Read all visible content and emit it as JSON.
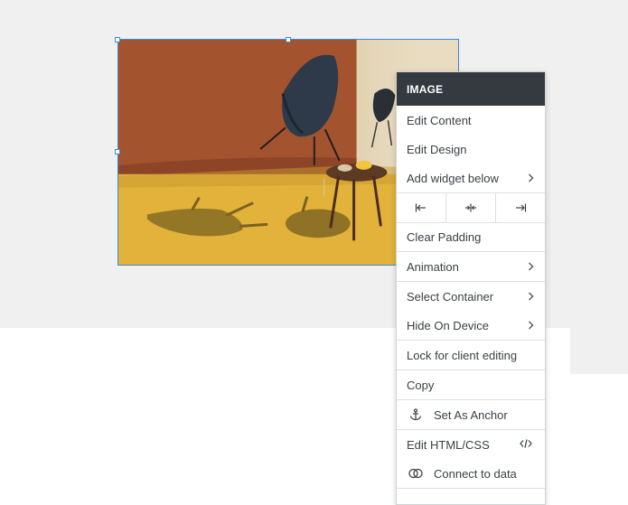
{
  "menu": {
    "header": "IMAGE",
    "edit_content": "Edit Content",
    "edit_design": "Edit Design",
    "add_widget_below": "Add widget below",
    "clear_padding": "Clear Padding",
    "animation": "Animation",
    "select_container": "Select Container",
    "hide_on_device": "Hide On Device",
    "lock_for_client_editing": "Lock for client editing",
    "copy": "Copy",
    "set_as_anchor": "Set As Anchor",
    "edit_html_css": "Edit HTML/CSS",
    "connect_to_data": "Connect to data"
  },
  "icons": {
    "align_left": "align-left-icon",
    "align_center": "align-center-icon",
    "align_right": "align-right-icon",
    "anchor": "anchor-icon",
    "code": "code-icon",
    "connect": "link-rings-icon",
    "chevron": "chevron-right-icon"
  },
  "colors": {
    "menu_header_bg": "#343a40",
    "selection_border": "#3b8bd1",
    "canvas_bg": "#f0f0f0"
  }
}
